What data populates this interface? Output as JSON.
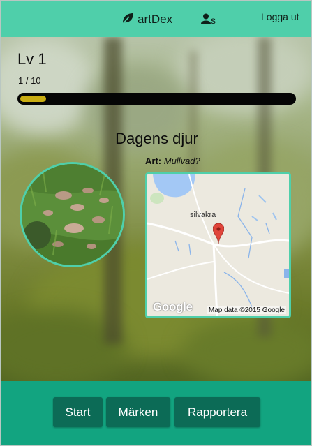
{
  "header": {
    "brand": "artDex",
    "brand_icon": "leaf-icon",
    "user_icon": "user-icon",
    "username": "s",
    "logout_label": "Logga ut",
    "color": "#4fcfaa"
  },
  "level": {
    "label": "Lv 1",
    "progress_text": "1 / 10",
    "progress_fraction": 0.1,
    "bar_color": "#c9ad12"
  },
  "daily": {
    "title": "Dagens djur",
    "species_label": "Art:",
    "species_value": "Mullvad?"
  },
  "map": {
    "place_label": "silvakra",
    "attribution": "Map data ©2015 Google",
    "logo": "Google",
    "marker_icon": "map-pin-icon"
  },
  "footer": {
    "color": "#12a480",
    "buttons": [
      {
        "label": "Start"
      },
      {
        "label": "Märken"
      },
      {
        "label": "Rapportera"
      }
    ]
  }
}
